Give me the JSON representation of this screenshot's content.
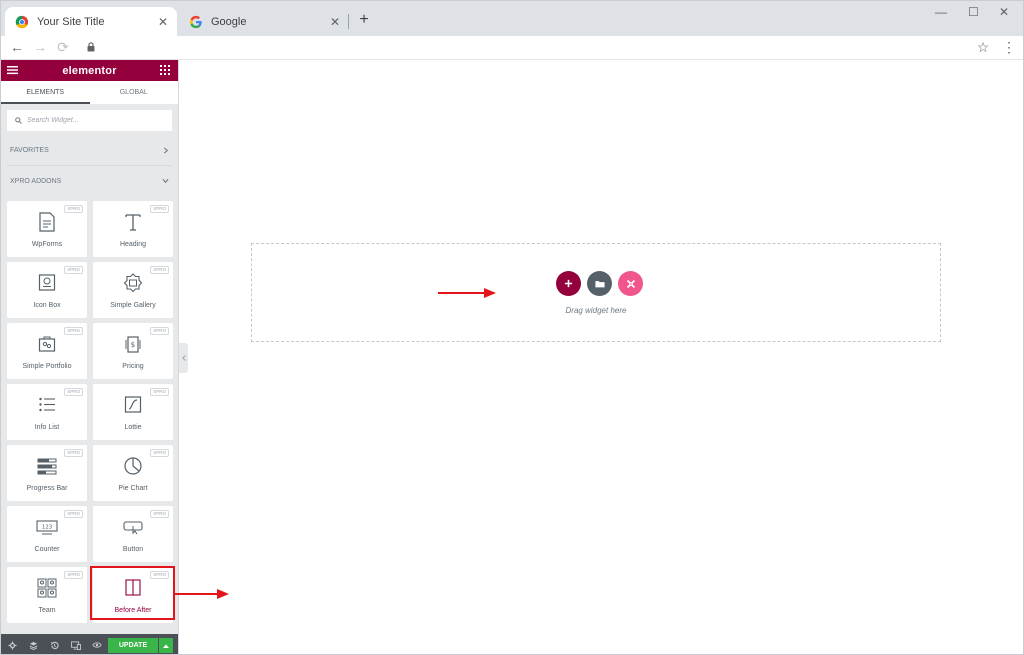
{
  "browser": {
    "tabs": [
      {
        "title": "Your Site Title",
        "active": true
      },
      {
        "title": "Google",
        "active": false
      }
    ],
    "close_glyph": "✕",
    "new_tab_glyph": "+",
    "window_controls": {
      "minimize": "—",
      "maximize": "☐",
      "close": "✕"
    },
    "nav": {
      "back": "←",
      "forward": "→",
      "reload": "⟳",
      "star": "☆",
      "menu": "⋮"
    }
  },
  "panel": {
    "logo": "elementor",
    "tabs": [
      "ELEMENTS",
      "GLOBAL"
    ],
    "search_placeholder": "Search Widget...",
    "sections": {
      "favorites": "FAVORITES",
      "addons": "XPRO ADDONS"
    },
    "badge": "XPRO",
    "widgets": [
      {
        "label": "WpForms",
        "icon": "wpforms-icon"
      },
      {
        "label": "Heading",
        "icon": "heading-icon"
      },
      {
        "label": "Icon Box",
        "icon": "icon-box-icon"
      },
      {
        "label": "Simple Gallery",
        "icon": "gallery-icon"
      },
      {
        "label": "Simple Portfolio",
        "icon": "portfolio-icon"
      },
      {
        "label": "Pricing",
        "icon": "pricing-icon"
      },
      {
        "label": "Info List",
        "icon": "info-list-icon"
      },
      {
        "label": "Lottie",
        "icon": "lottie-icon"
      },
      {
        "label": "Progress Bar",
        "icon": "progress-bar-icon"
      },
      {
        "label": "Pie Chart",
        "icon": "pie-chart-icon"
      },
      {
        "label": "Counter",
        "icon": "counter-icon"
      },
      {
        "label": "Button",
        "icon": "button-icon"
      },
      {
        "label": "Team",
        "icon": "team-icon"
      },
      {
        "label": "Before After",
        "icon": "before-after-icon"
      }
    ],
    "counter_icon_text": "123",
    "footer": {
      "update": "UPDATE"
    }
  },
  "canvas": {
    "drop_text": "Drag widget here"
  },
  "colors": {
    "brand": "#93003c",
    "update_green": "#39b54a",
    "folder_grey": "#556068",
    "xpro_pink": "#f0558c",
    "annotation_red": "#e3141a"
  }
}
